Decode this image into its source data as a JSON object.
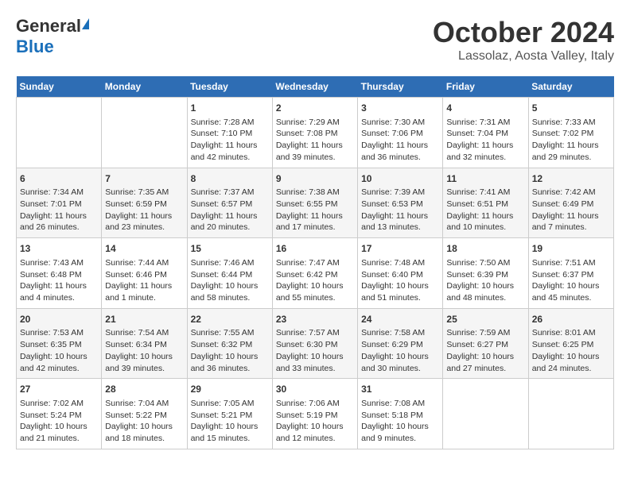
{
  "header": {
    "logo": {
      "general": "General",
      "blue": "Blue",
      "triangle": "▲"
    },
    "title": "October 2024",
    "subtitle": "Lassolaz, Aosta Valley, Italy"
  },
  "days_of_week": [
    "Sunday",
    "Monday",
    "Tuesday",
    "Wednesday",
    "Thursday",
    "Friday",
    "Saturday"
  ],
  "weeks": [
    [
      {
        "num": "",
        "info": ""
      },
      {
        "num": "",
        "info": ""
      },
      {
        "num": "1",
        "info": "Sunrise: 7:28 AM\nSunset: 7:10 PM\nDaylight: 11 hours and 42 minutes."
      },
      {
        "num": "2",
        "info": "Sunrise: 7:29 AM\nSunset: 7:08 PM\nDaylight: 11 hours and 39 minutes."
      },
      {
        "num": "3",
        "info": "Sunrise: 7:30 AM\nSunset: 7:06 PM\nDaylight: 11 hours and 36 minutes."
      },
      {
        "num": "4",
        "info": "Sunrise: 7:31 AM\nSunset: 7:04 PM\nDaylight: 11 hours and 32 minutes."
      },
      {
        "num": "5",
        "info": "Sunrise: 7:33 AM\nSunset: 7:02 PM\nDaylight: 11 hours and 29 minutes."
      }
    ],
    [
      {
        "num": "6",
        "info": "Sunrise: 7:34 AM\nSunset: 7:01 PM\nDaylight: 11 hours and 26 minutes."
      },
      {
        "num": "7",
        "info": "Sunrise: 7:35 AM\nSunset: 6:59 PM\nDaylight: 11 hours and 23 minutes."
      },
      {
        "num": "8",
        "info": "Sunrise: 7:37 AM\nSunset: 6:57 PM\nDaylight: 11 hours and 20 minutes."
      },
      {
        "num": "9",
        "info": "Sunrise: 7:38 AM\nSunset: 6:55 PM\nDaylight: 11 hours and 17 minutes."
      },
      {
        "num": "10",
        "info": "Sunrise: 7:39 AM\nSunset: 6:53 PM\nDaylight: 11 hours and 13 minutes."
      },
      {
        "num": "11",
        "info": "Sunrise: 7:41 AM\nSunset: 6:51 PM\nDaylight: 11 hours and 10 minutes."
      },
      {
        "num": "12",
        "info": "Sunrise: 7:42 AM\nSunset: 6:49 PM\nDaylight: 11 hours and 7 minutes."
      }
    ],
    [
      {
        "num": "13",
        "info": "Sunrise: 7:43 AM\nSunset: 6:48 PM\nDaylight: 11 hours and 4 minutes."
      },
      {
        "num": "14",
        "info": "Sunrise: 7:44 AM\nSunset: 6:46 PM\nDaylight: 11 hours and 1 minute."
      },
      {
        "num": "15",
        "info": "Sunrise: 7:46 AM\nSunset: 6:44 PM\nDaylight: 10 hours and 58 minutes."
      },
      {
        "num": "16",
        "info": "Sunrise: 7:47 AM\nSunset: 6:42 PM\nDaylight: 10 hours and 55 minutes."
      },
      {
        "num": "17",
        "info": "Sunrise: 7:48 AM\nSunset: 6:40 PM\nDaylight: 10 hours and 51 minutes."
      },
      {
        "num": "18",
        "info": "Sunrise: 7:50 AM\nSunset: 6:39 PM\nDaylight: 10 hours and 48 minutes."
      },
      {
        "num": "19",
        "info": "Sunrise: 7:51 AM\nSunset: 6:37 PM\nDaylight: 10 hours and 45 minutes."
      }
    ],
    [
      {
        "num": "20",
        "info": "Sunrise: 7:53 AM\nSunset: 6:35 PM\nDaylight: 10 hours and 42 minutes."
      },
      {
        "num": "21",
        "info": "Sunrise: 7:54 AM\nSunset: 6:34 PM\nDaylight: 10 hours and 39 minutes."
      },
      {
        "num": "22",
        "info": "Sunrise: 7:55 AM\nSunset: 6:32 PM\nDaylight: 10 hours and 36 minutes."
      },
      {
        "num": "23",
        "info": "Sunrise: 7:57 AM\nSunset: 6:30 PM\nDaylight: 10 hours and 33 minutes."
      },
      {
        "num": "24",
        "info": "Sunrise: 7:58 AM\nSunset: 6:29 PM\nDaylight: 10 hours and 30 minutes."
      },
      {
        "num": "25",
        "info": "Sunrise: 7:59 AM\nSunset: 6:27 PM\nDaylight: 10 hours and 27 minutes."
      },
      {
        "num": "26",
        "info": "Sunrise: 8:01 AM\nSunset: 6:25 PM\nDaylight: 10 hours and 24 minutes."
      }
    ],
    [
      {
        "num": "27",
        "info": "Sunrise: 7:02 AM\nSunset: 5:24 PM\nDaylight: 10 hours and 21 minutes."
      },
      {
        "num": "28",
        "info": "Sunrise: 7:04 AM\nSunset: 5:22 PM\nDaylight: 10 hours and 18 minutes."
      },
      {
        "num": "29",
        "info": "Sunrise: 7:05 AM\nSunset: 5:21 PM\nDaylight: 10 hours and 15 minutes."
      },
      {
        "num": "30",
        "info": "Sunrise: 7:06 AM\nSunset: 5:19 PM\nDaylight: 10 hours and 12 minutes."
      },
      {
        "num": "31",
        "info": "Sunrise: 7:08 AM\nSunset: 5:18 PM\nDaylight: 10 hours and 9 minutes."
      },
      {
        "num": "",
        "info": ""
      },
      {
        "num": "",
        "info": ""
      }
    ]
  ]
}
